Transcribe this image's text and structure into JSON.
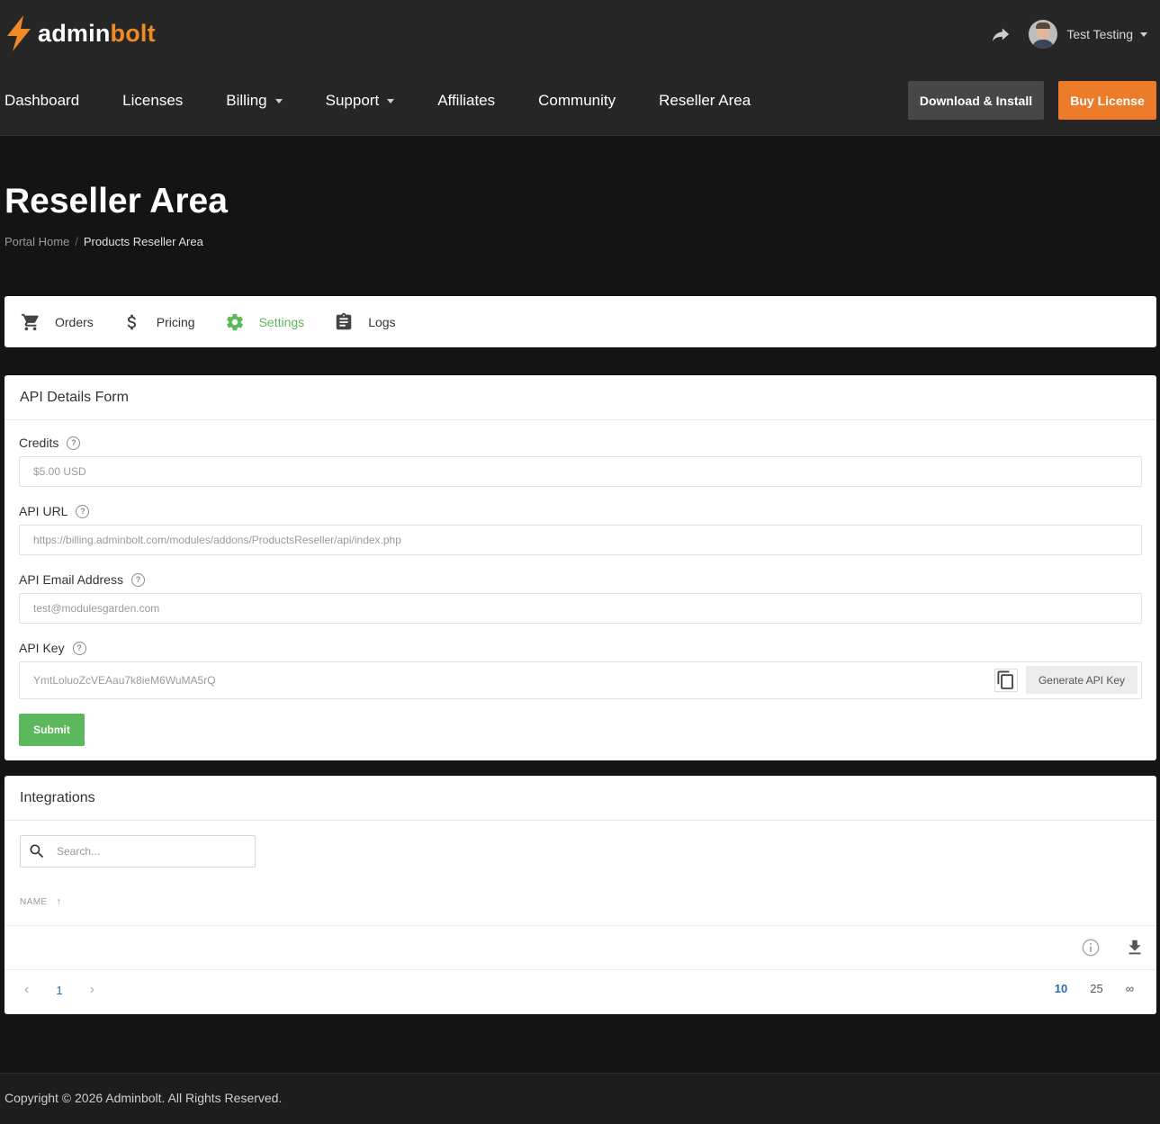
{
  "brand": {
    "part1": "admin",
    "part2": "bolt",
    "accent": "#f08a24"
  },
  "user": {
    "name": "Test Testing"
  },
  "nav": {
    "items": [
      {
        "label": "Dashboard"
      },
      {
        "label": "Licenses"
      },
      {
        "label": "Billing",
        "dropdown": true
      },
      {
        "label": "Support",
        "dropdown": true
      },
      {
        "label": "Affiliates"
      },
      {
        "label": "Community"
      },
      {
        "label": "Reseller Area"
      }
    ],
    "download_label": "Download & Install",
    "buy_label": "Buy License"
  },
  "page": {
    "title": "Reseller Area",
    "breadcrumb": {
      "home": "Portal Home",
      "current": "Products Reseller Area"
    }
  },
  "tabs": [
    {
      "label": "Orders",
      "icon": "cart-icon"
    },
    {
      "label": "Pricing",
      "icon": "dollar-icon"
    },
    {
      "label": "Settings",
      "icon": "gear-icon",
      "active": true
    },
    {
      "label": "Logs",
      "icon": "clipboard-icon"
    }
  ],
  "api_form": {
    "title": "API Details Form",
    "credits_label": "Credits",
    "credits_value": "$5.00 USD",
    "url_label": "API URL",
    "url_value": "https://billing.adminbolt.com/modules/addons/ProductsReseller/api/index.php",
    "email_label": "API Email Address",
    "email_value": "test@modulesgarden.com",
    "key_label": "API Key",
    "key_value": "YmtLoluoZcVEAau7k8ieM6WuMA5rQ",
    "generate_label": "Generate API Key",
    "submit_label": "Submit"
  },
  "integrations": {
    "title": "Integrations",
    "search_placeholder": "Search...",
    "column_name": "NAME",
    "page": "1",
    "page_sizes": [
      "10",
      "25",
      "∞"
    ],
    "active_page_size": "10"
  },
  "footer": {
    "copyright": "Copyright © 2026 Adminbolt. All Rights Reserved."
  },
  "colors": {
    "green": "#5cb85c",
    "orange": "#ec7c2a",
    "link_blue": "#2a6aad"
  }
}
